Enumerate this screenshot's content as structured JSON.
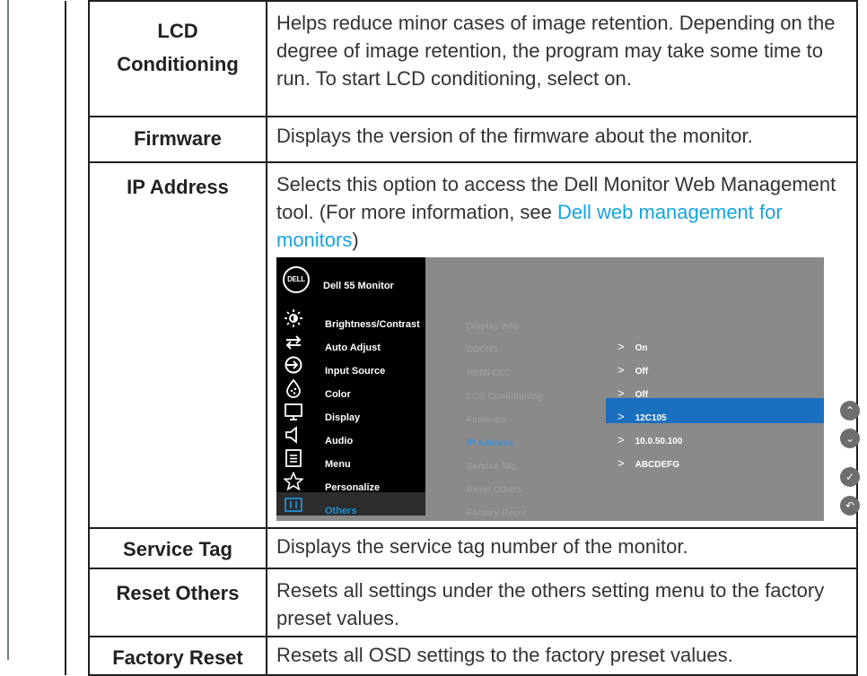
{
  "rows": [
    {
      "name": "LCD Conditioning",
      "name_line1": "LCD",
      "name_line2": "Conditioning",
      "desc": "Helps reduce minor cases of image retention. Depending on the degree of image retention, the program may take some time to run. To start LCD conditioning, select on."
    },
    {
      "name": "Firmware",
      "desc": "Displays the version of the firmware about the monitor."
    },
    {
      "name": "IP Address",
      "desc_pre": "Selects this option to access the Dell Monitor Web Management tool. (For more information, see ",
      "desc_link": "Dell web management for monitors",
      "desc_post": ")"
    },
    {
      "name": "Service Tag",
      "desc": "Displays the service tag number of the monitor."
    },
    {
      "name": "Reset Others",
      "desc": "Resets all settings under the others setting menu to the factory preset values."
    },
    {
      "name": "Factory Reset",
      "desc": "Resets all OSD settings to the factory preset values."
    }
  ],
  "osd": {
    "logo": "DELL",
    "title": "Dell 55 Monitor",
    "menu": [
      {
        "label": "Brightness/Contrast",
        "icon": "brightness-icon"
      },
      {
        "label": "Auto Adjust",
        "icon": "auto-adjust-icon"
      },
      {
        "label": "Input Source",
        "icon": "input-source-icon"
      },
      {
        "label": "Color",
        "icon": "color-icon"
      },
      {
        "label": "Display",
        "icon": "display-icon"
      },
      {
        "label": "Audio",
        "icon": "audio-icon"
      },
      {
        "label": "Menu",
        "icon": "menu-icon"
      },
      {
        "label": "Personalize",
        "icon": "star-icon"
      },
      {
        "label": "Others",
        "icon": "others-icon",
        "active": true
      }
    ],
    "submenu": [
      "Display Info",
      "DDC/CI",
      "HDMI CEC",
      "LCD Conditioning",
      "Firmware",
      "IP Address",
      "Service Tag",
      "Reset Others",
      "Factory Reset"
    ],
    "values": {
      "ddc": "On",
      "hdmi": "Off",
      "lcd": "Off",
      "firmware": "12C105",
      "ip": "10.0.50.100",
      "service_tag": "ABCDEFG"
    },
    "nav_buttons": [
      "up-icon",
      "down-icon",
      "check-icon",
      "back-icon"
    ],
    "colors": {
      "highlight": "#1a6fbf",
      "active_text": "#1e90d8",
      "link": "#17a3e0"
    }
  }
}
